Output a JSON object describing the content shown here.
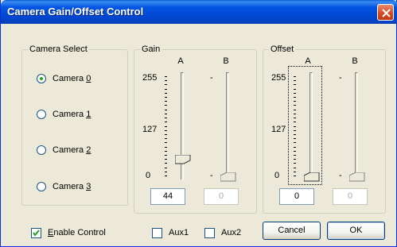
{
  "window": {
    "title": "Camera Gain/Offset Control"
  },
  "camera_select": {
    "label": "Camera Select",
    "options": [
      {
        "prefix": "Camera ",
        "key": "0",
        "checked": true
      },
      {
        "prefix": "Camera ",
        "key": "1",
        "checked": false
      },
      {
        "prefix": "Camera ",
        "key": "2",
        "checked": false
      },
      {
        "prefix": "Camera ",
        "key": "3",
        "checked": false
      }
    ]
  },
  "gain": {
    "label": "Gain",
    "col_a": "A",
    "col_b": "B",
    "scale_max": "255",
    "scale_mid": "127",
    "scale_min": "0",
    "scale_b": "-",
    "value_a": "44",
    "value_b": "0",
    "slider_a_value": 44,
    "slider_b_value": 0
  },
  "offset": {
    "label": "Offset",
    "col_a": "A",
    "col_b": "B",
    "scale_max": "255",
    "scale_mid": "127",
    "scale_min": "0",
    "scale_b": "-",
    "value_a": "0",
    "value_b": "0",
    "slider_a_value": 0,
    "slider_b_value": 0
  },
  "footer": {
    "enable_prefix": "",
    "enable_key": "E",
    "enable_rest": "nable Control",
    "enable_checked": true,
    "aux1": "Aux1",
    "aux1_checked": false,
    "aux2": "Aux2",
    "aux2_checked": false,
    "cancel": "Cancel",
    "ok": "OK"
  },
  "colors": {
    "title_bar": "#0055e5",
    "dialog_face": "#ece9d8",
    "close_button": "#d2471f",
    "radio_dot": "#21a121"
  },
  "icons": {
    "close": "close-x-icon",
    "check": "checkmark-icon"
  }
}
